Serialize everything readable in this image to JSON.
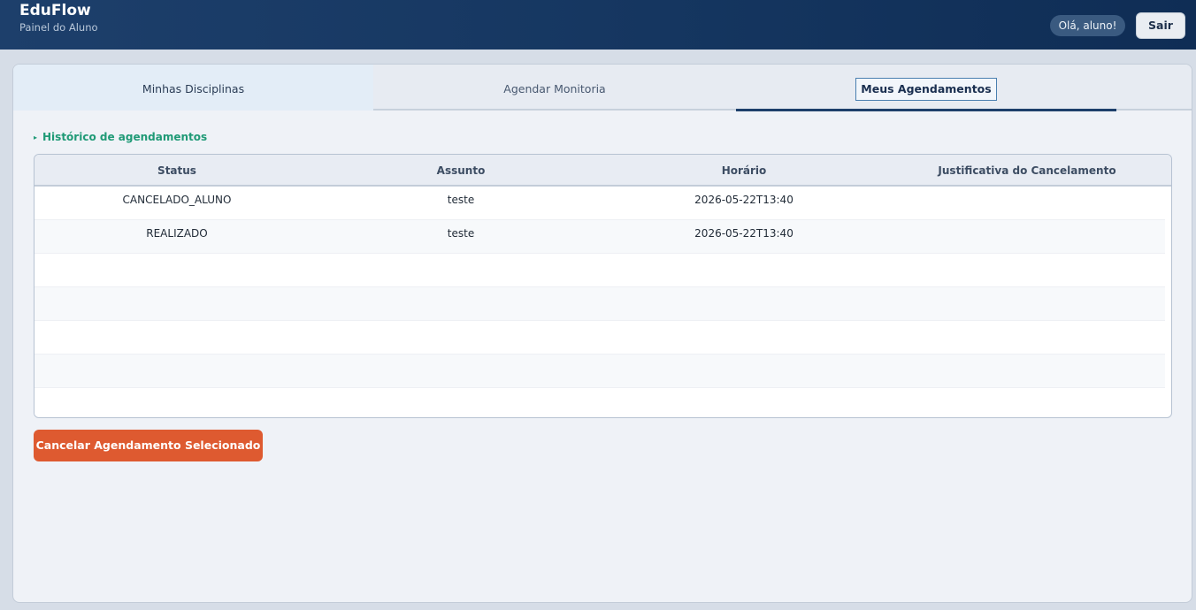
{
  "header": {
    "brand": "EduFlow",
    "subtitle": "Painel do Aluno",
    "greeting": "Olá, aluno!",
    "logout_label": "Sair"
  },
  "tabs": [
    {
      "label": "Minhas Disciplinas",
      "active": false
    },
    {
      "label": "Agendar Monitoria",
      "active": false
    },
    {
      "label": "Meus Agendamentos",
      "active": true
    }
  ],
  "section": {
    "title": "Histórico de agendamentos"
  },
  "table": {
    "columns": [
      "Status",
      "Assunto",
      "Horário",
      "Justificativa do Cancelamento"
    ],
    "rows": [
      {
        "status": "CANCELADO_ALUNO",
        "assunto": "teste",
        "horario": "2026-05-22T13:40",
        "justificativa": ""
      },
      {
        "status": "REALIZADO",
        "assunto": "teste",
        "horario": "2026-05-22T13:40",
        "justificativa": ""
      }
    ]
  },
  "actions": {
    "cancel_label": "Cancelar Agendamento Selecionado"
  },
  "colors": {
    "header_bg": "#153660",
    "accent_green": "#1f9a76",
    "danger": "#de5a30"
  }
}
